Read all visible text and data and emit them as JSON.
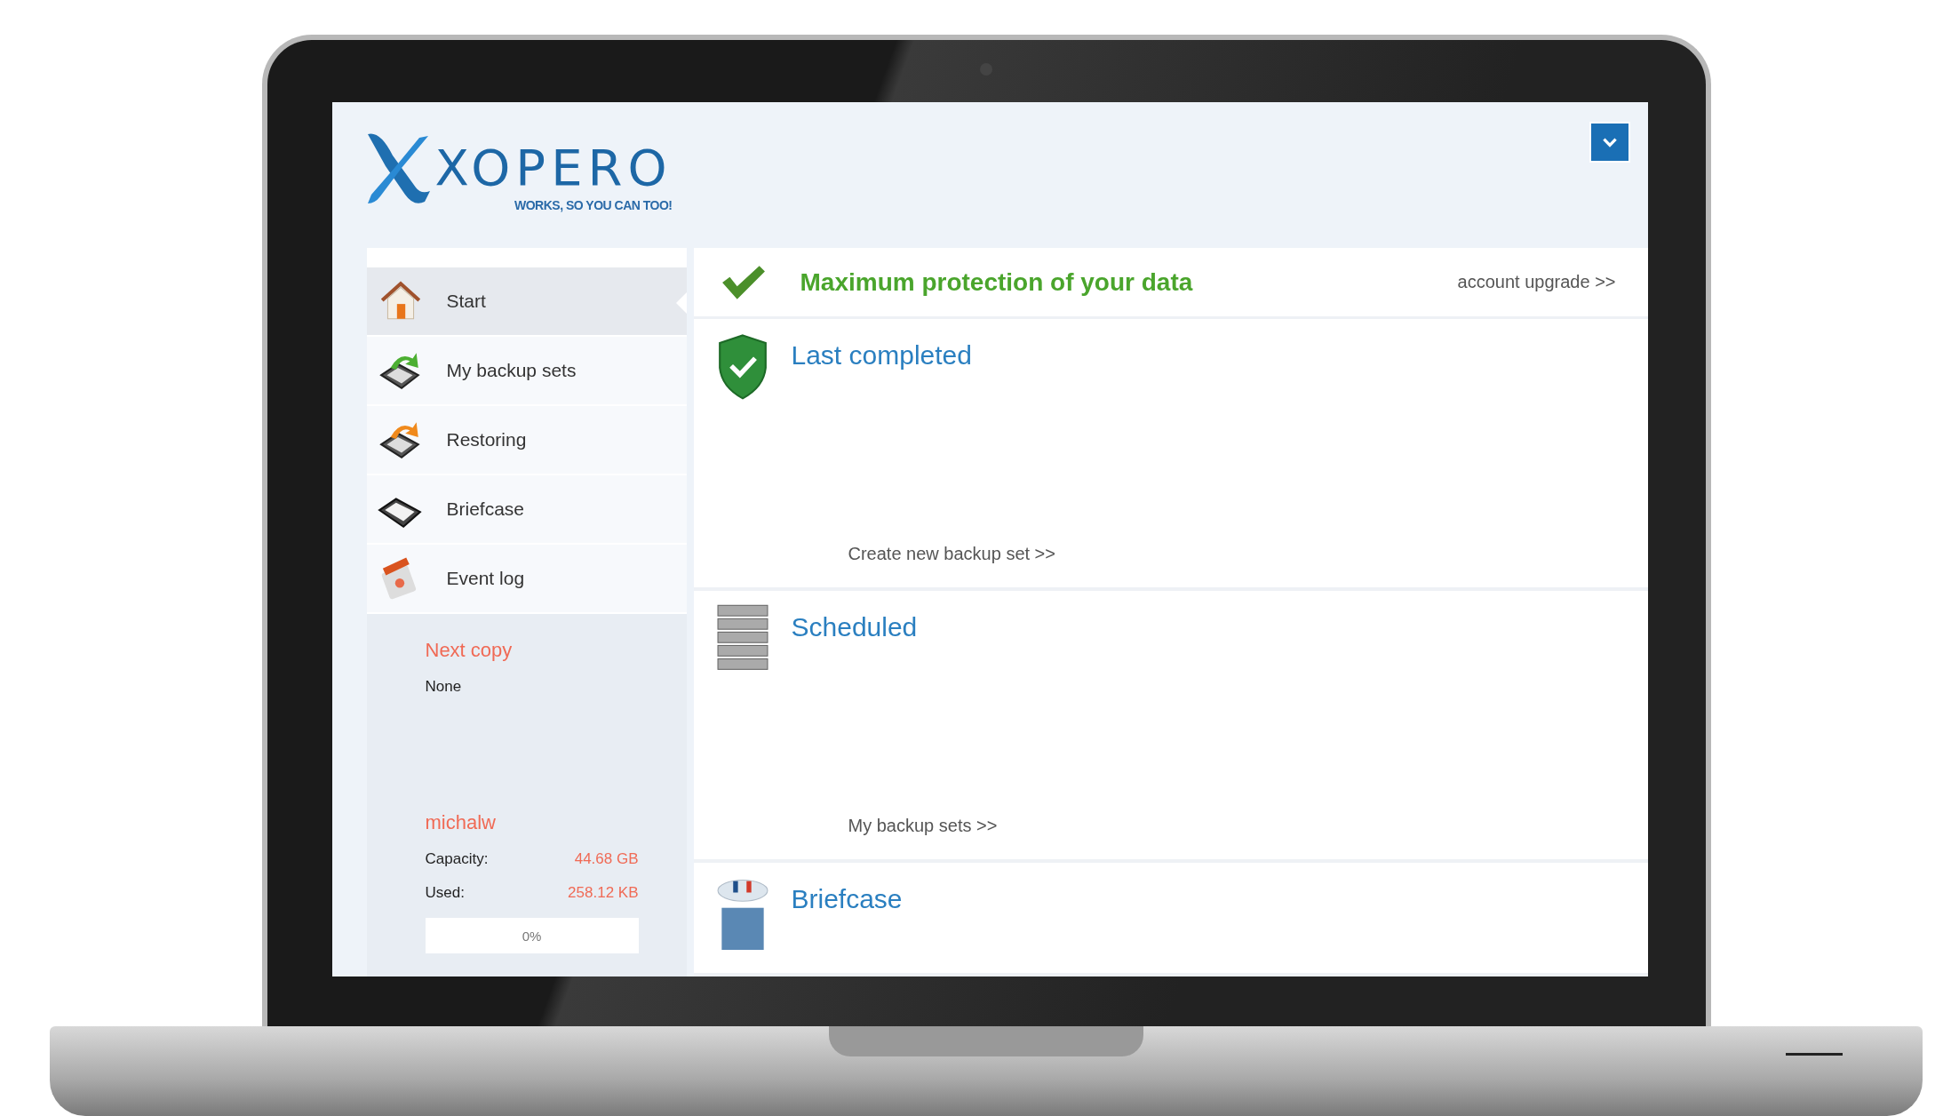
{
  "header": {
    "logo": "XOPERO",
    "tagline": "WORKS, SO YOU CAN TOO!"
  },
  "sidebar": {
    "items": [
      {
        "label": "Start",
        "selected": true
      },
      {
        "label": "My backup sets",
        "selected": false
      },
      {
        "label": "Restoring",
        "selected": false
      },
      {
        "label": "Briefcase",
        "selected": false
      },
      {
        "label": "Event log",
        "selected": false
      }
    ],
    "next_copy": {
      "title": "Next copy",
      "value": "None"
    },
    "account": {
      "name": "michalw",
      "rows": [
        {
          "label": "Capacity:",
          "value": "44.68 GB"
        },
        {
          "label": "Used:",
          "value": "258.12 KB"
        }
      ],
      "usage": {
        "level": 0,
        "reading": "0%"
      }
    }
  },
  "main": {
    "banner": {
      "title": "Maximum protection of your data",
      "link": "account upgrade >>"
    },
    "sections": [
      {
        "title": "Last completed",
        "link": "Create new backup set >>"
      },
      {
        "title": "Scheduled",
        "link": "My backup sets >>"
      },
      {
        "title": "Briefcase"
      }
    ]
  }
}
